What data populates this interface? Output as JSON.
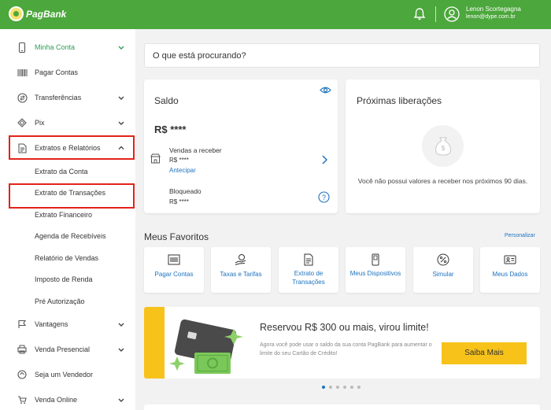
{
  "header": {
    "logo_text": "PagBank",
    "user_name": "Lenon Scortegagna",
    "user_email": "lenon@dype.com.br",
    "brand_color": "#4ca73c"
  },
  "sidebar": {
    "items": [
      {
        "label": "Minha Conta",
        "icon": "phone-icon",
        "expanded": true
      },
      {
        "label": "Pagar Contas",
        "icon": "barcode-icon"
      },
      {
        "label": "Transferências",
        "icon": "transfer-icon"
      },
      {
        "label": "Pix",
        "icon": "pix-icon"
      },
      {
        "label": "Extratos e Relatórios",
        "icon": "document-icon",
        "expanded": true
      },
      {
        "label": "Vantagens",
        "icon": "flag-icon"
      },
      {
        "label": "Venda Presencial",
        "icon": "printer-icon"
      },
      {
        "label": "Seja um Vendedor",
        "icon": "store-icon"
      },
      {
        "label": "Venda Online",
        "icon": "cart-icon"
      }
    ],
    "subitems": [
      "Extrato da Conta",
      "Extrato de Transações",
      "Extrato Financeiro",
      "Agenda de Recebíveis",
      "Relatório de Vendas",
      "Imposto de Renda",
      "Pré Autorização"
    ]
  },
  "search": {
    "placeholder": "O que está procurando?"
  },
  "saldo": {
    "title": "Saldo",
    "balance": "R$ ****",
    "vendas_label": "Vendas a receber",
    "vendas_value": "R$ ****",
    "anticipate": "Antecipar",
    "bloqueado_label": "Bloqueado",
    "bloqueado_value": "R$ ****"
  },
  "liberacoes": {
    "title": "Próximas liberações",
    "empty_text": "Você não possui valores a receber nos próximos 90 dias."
  },
  "favorites": {
    "title": "Meus Favoritos",
    "personalize": "Personalizar",
    "items": [
      {
        "label": "Pagar Contas",
        "icon": "barcode-icon"
      },
      {
        "label": "Taxas e Tarifas",
        "icon": "hand-coin-icon"
      },
      {
        "label": "Extrato de Transações",
        "icon": "document-icon"
      },
      {
        "label": "Meus Dispositivos",
        "icon": "device-icon"
      },
      {
        "label": "Simular",
        "icon": "percent-icon"
      },
      {
        "label": "Meus Dados",
        "icon": "id-card-icon"
      }
    ]
  },
  "banner": {
    "title": "Reservou R$ 300 ou mais, virou limite!",
    "text": "Agora você pode usar o saldo da sua conta PagBank para aumentar o limite do seu Cartão de Crédito!",
    "button": "Saiba Mais"
  },
  "carousel": {
    "count": 6,
    "active": 1
  },
  "colors": {
    "accent_blue": "#1e73be",
    "yellow": "#f7c21a",
    "highlight_red": "#e2231a"
  }
}
